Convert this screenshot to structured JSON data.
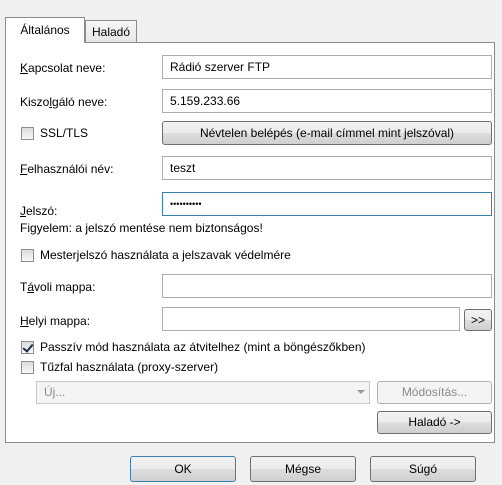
{
  "tabs": [
    {
      "label": "Általános",
      "active": true
    },
    {
      "label": "Haladó",
      "active": false
    }
  ],
  "fields": {
    "connection_name": {
      "label_pre": "",
      "label_u": "K",
      "label_post": "apcsolat neve:",
      "value": "Rádió szerver FTP"
    },
    "server_name": {
      "label_pre": "Kiszo",
      "label_u": "l",
      "label_post": "gáló neve:",
      "value": "5.159.233.66"
    },
    "username": {
      "label_pre": "",
      "label_u": "F",
      "label_post": "elhasználói név:",
      "value": "teszt"
    },
    "password": {
      "label_pre": "",
      "label_u": "J",
      "label_post": "elszó:",
      "value": "••••••••••"
    },
    "remote_folder": {
      "label_pre": "T",
      "label_u": "á",
      "label_post": "voli mappa:",
      "value": ""
    },
    "local_folder": {
      "label_pre": "",
      "label_u": "H",
      "label_post": "elyi mappa:",
      "value": ""
    }
  },
  "ssl": {
    "label": "SSL/TLS",
    "checked": false
  },
  "anonymous_button": "Névtelen belépés (e-mail címmel mint jelszóval)",
  "warning": "Figyelem: a jelszó mentése nem biztonságos!",
  "master_password": {
    "label": "Mesterjelszó használata a jelszavak védelmére",
    "checked": false
  },
  "browse_button": ">>",
  "passive_mode": {
    "label": "Passzív mód használata az átvitelhez (mint a böngészőkben)",
    "checked": true
  },
  "firewall": {
    "label": "Tűzfal használata (proxy-szerver)",
    "checked": false
  },
  "proxy_combo": {
    "value": "Új..."
  },
  "modify_button": "Módosítás...",
  "advanced_button": "Haladó ->",
  "footer": {
    "ok": "OK",
    "cancel": "Mégse",
    "help": "Súgó"
  },
  "colors": {
    "focus_border": "#3c7fb1",
    "panel_bg": "#ffffff",
    "window_bg": "#f0f0f0"
  }
}
